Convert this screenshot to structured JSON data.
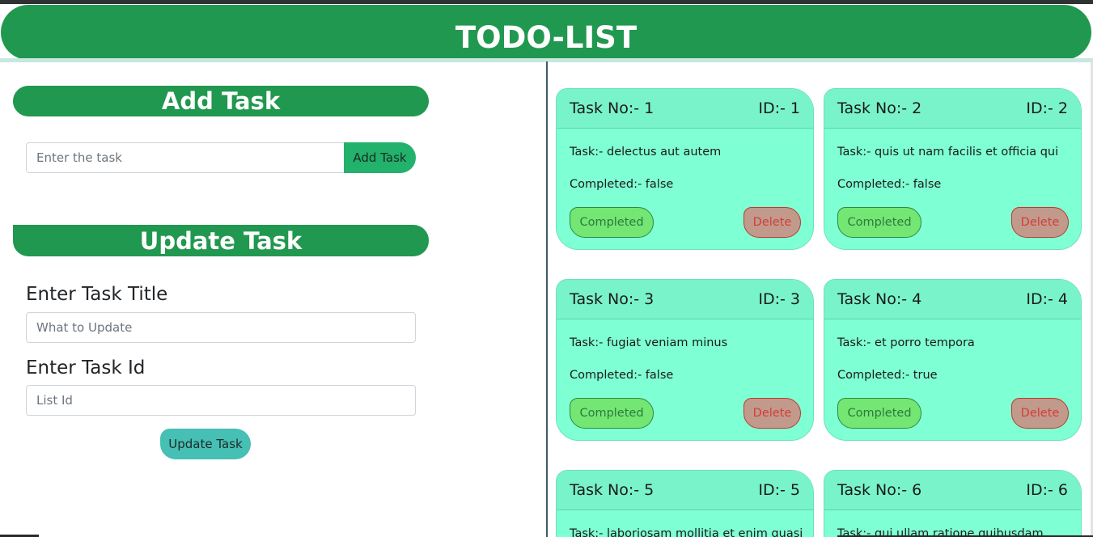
{
  "app": {
    "title": "TODO-LIST"
  },
  "add_section": {
    "heading": "Add Task",
    "input_placeholder": "Enter the task",
    "button_label": "Add Task"
  },
  "update_section": {
    "heading": "Update Task",
    "title_label": "Enter Task Title",
    "title_placeholder": "What to Update",
    "id_label": "Enter Task Id",
    "id_placeholder": "List Id",
    "button_label": "Update Task"
  },
  "cards": [
    {
      "task_no": "Task No:- 1",
      "id": "ID:- 1",
      "task": "Task:- delectus aut autem",
      "completed": "Completed:- false",
      "complete_btn": "Completed",
      "delete_btn": "Delete"
    },
    {
      "task_no": "Task No:- 2",
      "id": "ID:- 2",
      "task": "Task:- quis ut nam facilis et officia qui",
      "completed": "Completed:- false",
      "complete_btn": "Completed",
      "delete_btn": "Delete"
    },
    {
      "task_no": "Task No:- 3",
      "id": "ID:- 3",
      "task": "Task:- fugiat veniam minus",
      "completed": "Completed:- false",
      "complete_btn": "Completed",
      "delete_btn": "Delete"
    },
    {
      "task_no": "Task No:- 4",
      "id": "ID:- 4",
      "task": "Task:- et porro tempora",
      "completed": "Completed:- true",
      "complete_btn": "Completed",
      "delete_btn": "Delete"
    },
    {
      "task_no": "Task No:- 5",
      "id": "ID:- 5",
      "task": "Task:- laboriosam mollitia et enim quasi",
      "completed": "",
      "complete_btn": "",
      "delete_btn": ""
    },
    {
      "task_no": "Task No:- 6",
      "id": "ID:- 6",
      "task": "Task:- qui ullam ratione quibusdam",
      "completed": "",
      "complete_btn": "",
      "delete_btn": ""
    }
  ],
  "colors": {
    "brand_green": "#21984f",
    "card_bg": "#7fffd4",
    "complete_btn": "#73e674",
    "delete_btn": "#c19a8c",
    "update_btn": "#46bfb4"
  }
}
